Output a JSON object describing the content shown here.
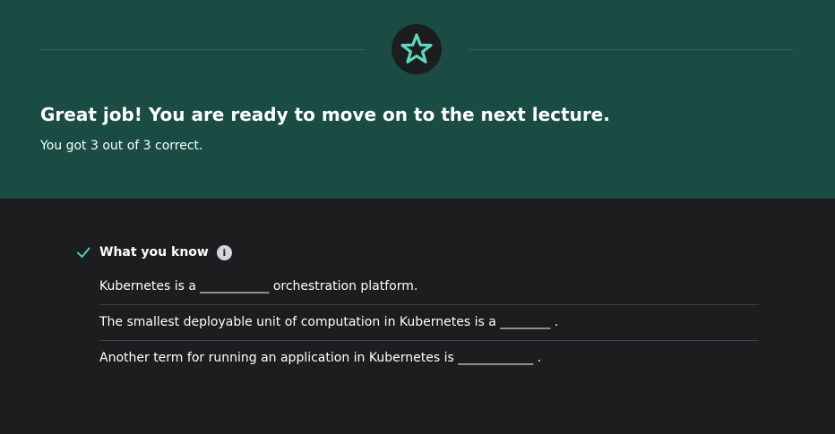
{
  "banner": {
    "headline": "Great job! You are ready to move on to the next lecture.",
    "score_text": "You got 3 out of 3 correct.",
    "badge_icon": "star-icon",
    "accent_color": "#5dd9c1",
    "background_color": "#1a4c44"
  },
  "knowledge": {
    "title": "What you know",
    "status_icon": "check-icon",
    "info_icon": "info-icon",
    "info_glyph": "i",
    "questions": [
      "Kubernetes is a  ___________ orchestration platform.",
      "The smallest deployable unit of computation in Kubernetes is a ________ .",
      "Another term for running an application in Kubernetes is ____________ ."
    ]
  }
}
